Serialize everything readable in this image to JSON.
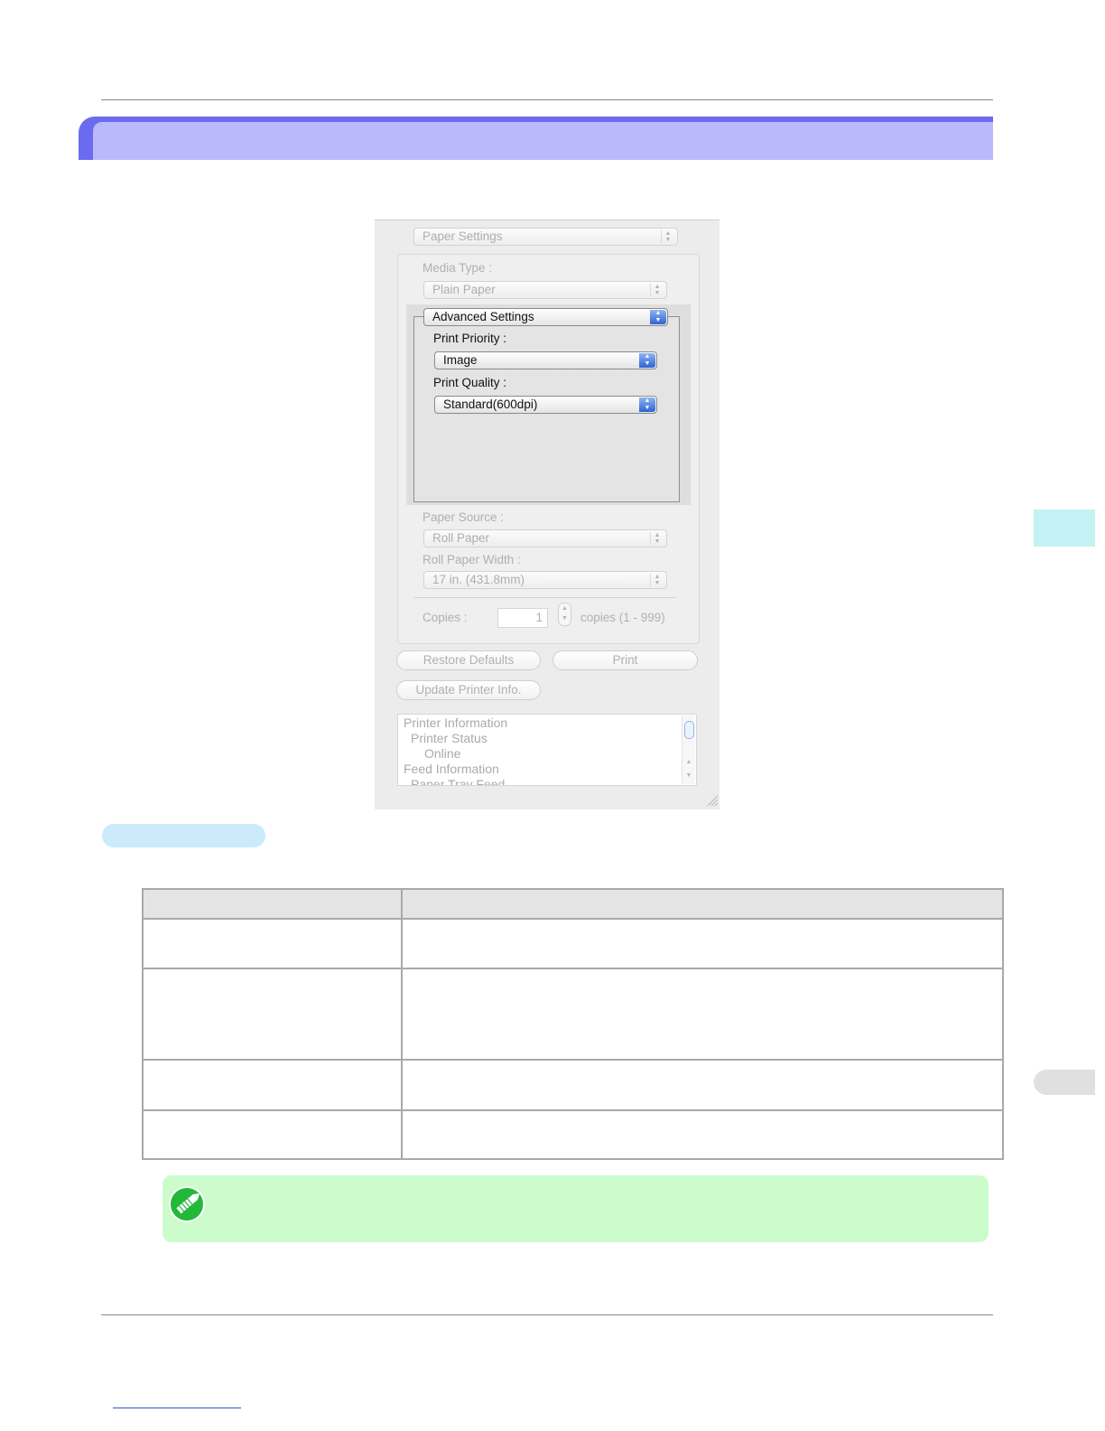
{
  "dialog": {
    "section_popup": "Paper Settings",
    "media_type_label": "Media Type :",
    "media_type_value": "Plain Paper",
    "advanced_popup": "Advanced Settings",
    "print_priority_label": "Print Priority :",
    "print_priority_value": "Image",
    "print_quality_label": "Print Quality :",
    "print_quality_value": "Standard(600dpi)",
    "paper_source_label": "Paper Source :",
    "paper_source_value": "Roll Paper",
    "roll_width_label": "Roll Paper Width :",
    "roll_width_value": "17 in. (431.8mm)",
    "copies_label": "Copies :",
    "copies_value": "1",
    "copies_range": "copies (1 - 999)",
    "restore_defaults": "Restore Defaults",
    "print": "Print",
    "update_printer_info": "Update Printer Info.",
    "info_items": [
      "Printer Information",
      "Printer Status",
      "Online",
      "Feed Information",
      "Paper Tray Feed"
    ]
  },
  "colors": {
    "title_bar_dark": "#6b6bef",
    "title_bar_light": "#b9b9fb",
    "note_bg": "#ccfccc",
    "note_icon": "#22b83a",
    "side_tab": "#c4f1f3",
    "section_pill": "#cbeafc"
  },
  "icons": {
    "note": "pencil-icon",
    "resize": "resize-grip-icon"
  }
}
